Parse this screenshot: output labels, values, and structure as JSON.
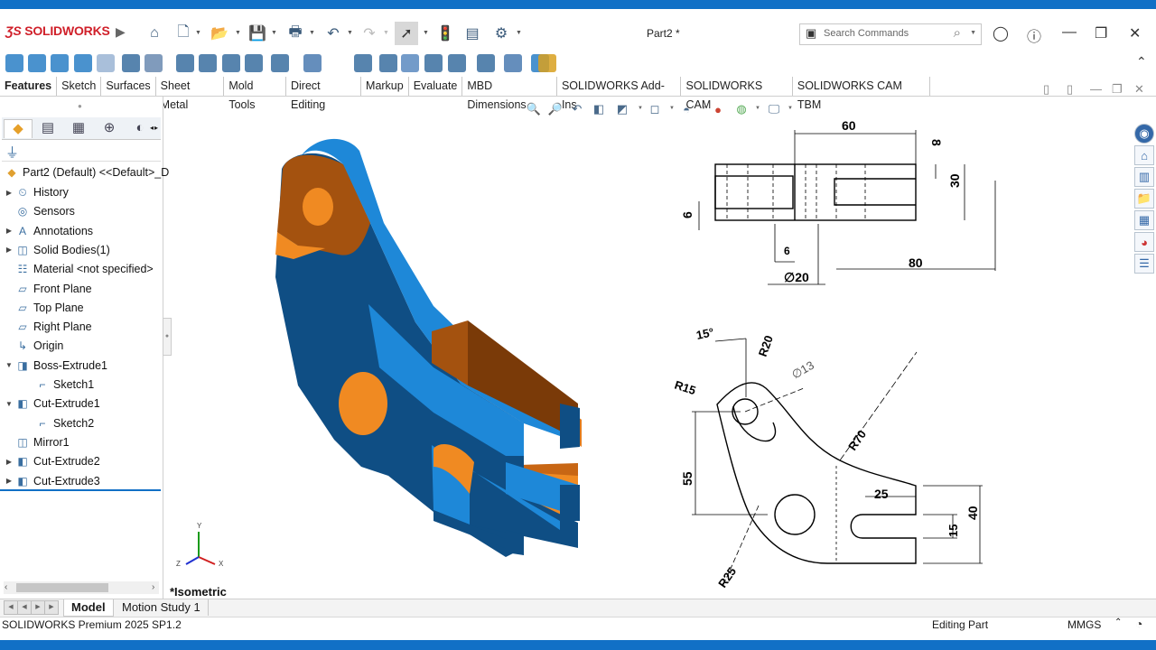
{
  "app": {
    "brand": "SOLIDWORKS",
    "document_title": "Part2 *",
    "search_placeholder": "Search Commands",
    "accent_color": "#1170c6",
    "brand_color": "#d0202a"
  },
  "tabs": [
    "Features",
    "Sketch",
    "Surfaces",
    "Sheet Metal",
    "Mold Tools",
    "Direct Editing",
    "Markup",
    "Evaluate",
    "MBD Dimensions",
    "SOLIDWORKS Add-Ins",
    "SOLIDWORKS CAM",
    "SOLIDWORKS CAM TBM"
  ],
  "tree": {
    "root": "Part2 (Default) <<Default>_D",
    "items": [
      {
        "label": "History",
        "icon": "history-icon",
        "arrow": true,
        "indent": 0
      },
      {
        "label": "Sensors",
        "icon": "sensors-icon",
        "arrow": false,
        "indent": 0
      },
      {
        "label": "Annotations",
        "icon": "annotations-icon",
        "arrow": true,
        "indent": 0
      },
      {
        "label": "Solid Bodies(1)",
        "icon": "solid-bodies-icon",
        "arrow": true,
        "indent": 0
      },
      {
        "label": "Material <not specified>",
        "icon": "material-icon",
        "arrow": false,
        "indent": 0
      },
      {
        "label": "Front Plane",
        "icon": "plane-icon",
        "arrow": false,
        "indent": 0
      },
      {
        "label": "Top Plane",
        "icon": "plane-icon",
        "arrow": false,
        "indent": 0
      },
      {
        "label": "Right Plane",
        "icon": "plane-icon",
        "arrow": false,
        "indent": 0
      },
      {
        "label": "Origin",
        "icon": "origin-icon",
        "arrow": false,
        "indent": 0
      },
      {
        "label": "Boss-Extrude1",
        "icon": "extrude-icon",
        "arrow": true,
        "indent": 0
      },
      {
        "label": "Sketch1",
        "icon": "sketch-icon",
        "arrow": false,
        "indent": 1
      },
      {
        "label": "Cut-Extrude1",
        "icon": "cut-extrude-icon",
        "arrow": true,
        "indent": 0
      },
      {
        "label": "Sketch2",
        "icon": "sketch-icon",
        "arrow": false,
        "indent": 1
      },
      {
        "label": "Mirror1",
        "icon": "mirror-icon",
        "arrow": false,
        "indent": 0
      },
      {
        "label": "Cut-Extrude2",
        "icon": "cut-extrude-icon",
        "arrow": true,
        "indent": 0
      },
      {
        "label": "Cut-Extrude3",
        "icon": "cut-extrude-icon",
        "arrow": true,
        "indent": 0
      }
    ]
  },
  "viewport": {
    "view_name": "*Isometric",
    "axis_labels": {
      "x": "X",
      "y": "Y",
      "z": "Z"
    }
  },
  "drawing": {
    "top_view": {
      "d60": "60",
      "d8": "8",
      "d30": "30",
      "d6a": "6",
      "d6b": "6",
      "dphi20": "∅20",
      "d80": "80"
    },
    "front_view": {
      "a15": "15°",
      "r20": "R20",
      "phi13": "∅13",
      "r15": "R15",
      "r70": "R70",
      "d55": "55",
      "d25": "25",
      "d15": "15",
      "d40": "40",
      "r25": "R25"
    }
  },
  "bottom_tabs": [
    "Model",
    "Motion Study 1"
  ],
  "status": {
    "left": "SOLIDWORKS Premium 2025 SP1.2",
    "mode": "Editing Part",
    "units": "MMGS"
  }
}
